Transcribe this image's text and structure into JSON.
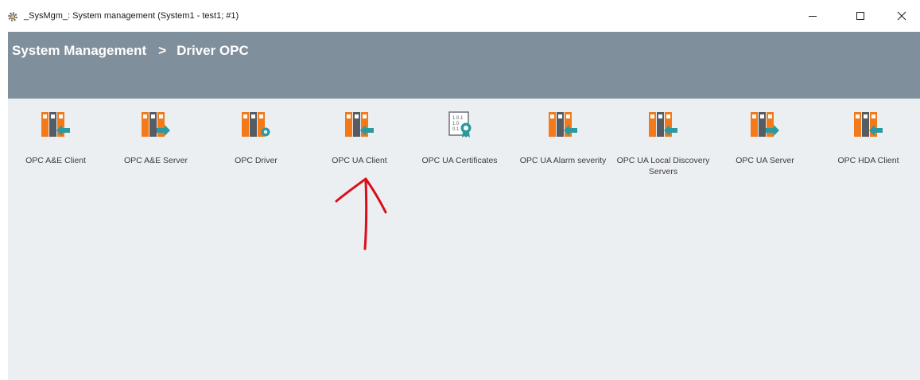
{
  "window": {
    "title": "_SysMgm_: System management (System1 - test1; #1)",
    "icon": "gear-icon"
  },
  "breadcrumb": {
    "root": "System Management",
    "separator": ">",
    "current": "Driver OPC"
  },
  "colors": {
    "header": "#808f9c",
    "content_bg": "#eceff2",
    "icon_orange": "#f27a1a",
    "icon_teal": "#2b9aa0",
    "annotation_red": "#d9101a"
  },
  "tiles": [
    {
      "label": "OPC A&E Client",
      "icon": "opc-client-icon"
    },
    {
      "label": "OPC A&E Server",
      "icon": "opc-server-icon"
    },
    {
      "label": "OPC Driver",
      "icon": "opc-driver-icon"
    },
    {
      "label": "OPC UA Client",
      "icon": "opc-client-icon"
    },
    {
      "label": "OPC UA Certificates",
      "icon": "certificate-icon"
    },
    {
      "label": "OPC UA Alarm severity",
      "icon": "opc-client-icon"
    },
    {
      "label": "OPC UA Local Discovery Servers",
      "icon": "opc-client-icon"
    },
    {
      "label": "OPC UA Server",
      "icon": "opc-server-icon"
    },
    {
      "label": "OPC HDA Client",
      "icon": "opc-client-icon"
    }
  ]
}
